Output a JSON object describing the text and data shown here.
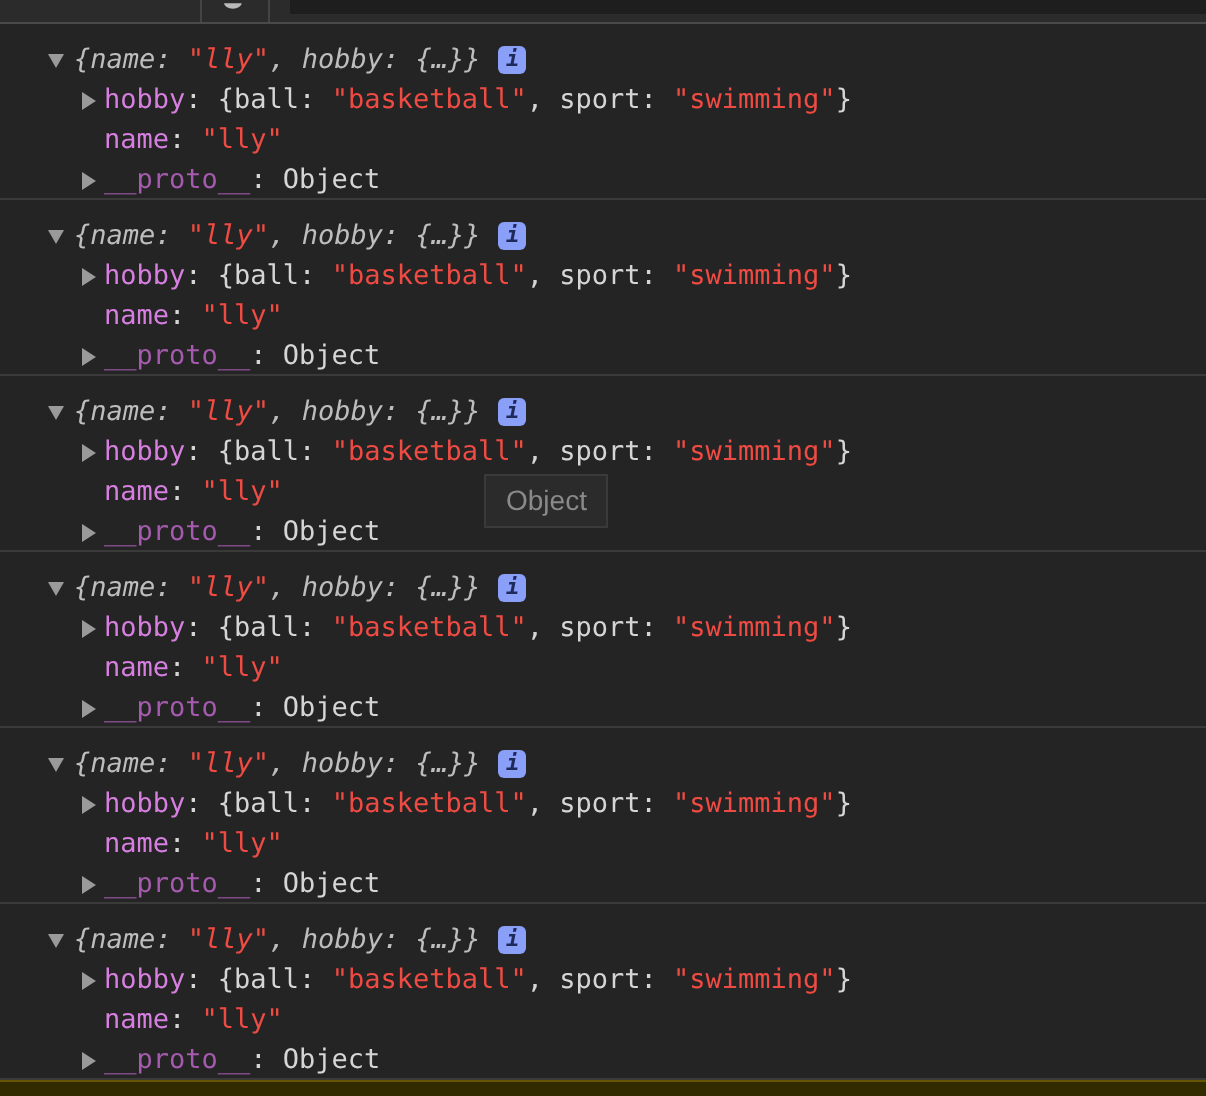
{
  "entries": [
    {
      "expanded": true,
      "badge": "i",
      "summary": [
        {
          "kind": "punct",
          "text": "{"
        },
        {
          "kind": "key",
          "text": "name"
        },
        {
          "kind": "punct",
          "text": ": "
        },
        {
          "kind": "string",
          "text": "\"lly\""
        },
        {
          "kind": "punct",
          "text": ", "
        },
        {
          "kind": "key",
          "text": "hobby"
        },
        {
          "kind": "punct",
          "text": ": {…}}"
        }
      ],
      "properties": [
        {
          "kind": "object",
          "expanded": false,
          "tokens": [
            {
              "kind": "key",
              "text": "hobby"
            },
            {
              "kind": "punct",
              "text": ": {"
            },
            {
              "kind": "plain",
              "text": "ball: "
            },
            {
              "kind": "string",
              "text": "\"basketball\""
            },
            {
              "kind": "punct",
              "text": ", "
            },
            {
              "kind": "plain",
              "text": "sport: "
            },
            {
              "kind": "string",
              "text": "\"swimming\""
            },
            {
              "kind": "punct",
              "text": "}"
            }
          ]
        },
        {
          "kind": "value",
          "tokens": [
            {
              "kind": "key",
              "text": "name"
            },
            {
              "kind": "punct",
              "text": ": "
            },
            {
              "kind": "string",
              "text": "\"lly\""
            }
          ]
        },
        {
          "kind": "object",
          "expanded": false,
          "tokens": [
            {
              "kind": "key_dim",
              "text": "__proto__"
            },
            {
              "kind": "punct",
              "text": ": "
            },
            {
              "kind": "plain",
              "text": "Object"
            }
          ]
        }
      ]
    },
    {
      "expanded": true,
      "badge": "i",
      "summary": [
        {
          "kind": "punct",
          "text": "{"
        },
        {
          "kind": "key",
          "text": "name"
        },
        {
          "kind": "punct",
          "text": ": "
        },
        {
          "kind": "string",
          "text": "\"lly\""
        },
        {
          "kind": "punct",
          "text": ", "
        },
        {
          "kind": "key",
          "text": "hobby"
        },
        {
          "kind": "punct",
          "text": ": {…}}"
        }
      ],
      "properties": [
        {
          "kind": "object",
          "expanded": false,
          "tokens": [
            {
              "kind": "key",
              "text": "hobby"
            },
            {
              "kind": "punct",
              "text": ": {"
            },
            {
              "kind": "plain",
              "text": "ball: "
            },
            {
              "kind": "string",
              "text": "\"basketball\""
            },
            {
              "kind": "punct",
              "text": ", "
            },
            {
              "kind": "plain",
              "text": "sport: "
            },
            {
              "kind": "string",
              "text": "\"swimming\""
            },
            {
              "kind": "punct",
              "text": "}"
            }
          ]
        },
        {
          "kind": "value",
          "tokens": [
            {
              "kind": "key",
              "text": "name"
            },
            {
              "kind": "punct",
              "text": ": "
            },
            {
              "kind": "string",
              "text": "\"lly\""
            }
          ]
        },
        {
          "kind": "object",
          "expanded": false,
          "tokens": [
            {
              "kind": "key_dim",
              "text": "__proto__"
            },
            {
              "kind": "punct",
              "text": ": "
            },
            {
              "kind": "plain",
              "text": "Object"
            }
          ]
        }
      ]
    },
    {
      "expanded": true,
      "badge": "i",
      "tooltip": "Object",
      "summary": [
        {
          "kind": "punct",
          "text": "{"
        },
        {
          "kind": "key",
          "text": "name"
        },
        {
          "kind": "punct",
          "text": ": "
        },
        {
          "kind": "string",
          "text": "\"lly\""
        },
        {
          "kind": "punct",
          "text": ", "
        },
        {
          "kind": "key",
          "text": "hobby"
        },
        {
          "kind": "punct",
          "text": ": {…}}"
        }
      ],
      "properties": [
        {
          "kind": "object",
          "expanded": false,
          "tokens": [
            {
              "kind": "key",
              "text": "hobby"
            },
            {
              "kind": "punct",
              "text": ": {"
            },
            {
              "kind": "plain",
              "text": "ball: "
            },
            {
              "kind": "string",
              "text": "\"basketball\""
            },
            {
              "kind": "punct",
              "text": ", "
            },
            {
              "kind": "plain",
              "text": "sport: "
            },
            {
              "kind": "string",
              "text": "\"swimming\""
            },
            {
              "kind": "punct",
              "text": "}"
            }
          ]
        },
        {
          "kind": "value",
          "tokens": [
            {
              "kind": "key",
              "text": "name"
            },
            {
              "kind": "punct",
              "text": ": "
            },
            {
              "kind": "string",
              "text": "\"lly\""
            }
          ]
        },
        {
          "kind": "object",
          "expanded": false,
          "tokens": [
            {
              "kind": "key_dim",
              "text": "__proto__"
            },
            {
              "kind": "punct",
              "text": ": "
            },
            {
              "kind": "plain",
              "text": "Object"
            }
          ]
        }
      ]
    },
    {
      "expanded": true,
      "badge": "i",
      "summary": [
        {
          "kind": "punct",
          "text": "{"
        },
        {
          "kind": "key",
          "text": "name"
        },
        {
          "kind": "punct",
          "text": ": "
        },
        {
          "kind": "string",
          "text": "\"lly\""
        },
        {
          "kind": "punct",
          "text": ", "
        },
        {
          "kind": "key",
          "text": "hobby"
        },
        {
          "kind": "punct",
          "text": ": {…}}"
        }
      ],
      "properties": [
        {
          "kind": "object",
          "expanded": false,
          "tokens": [
            {
              "kind": "key",
              "text": "hobby"
            },
            {
              "kind": "punct",
              "text": ": {"
            },
            {
              "kind": "plain",
              "text": "ball: "
            },
            {
              "kind": "string",
              "text": "\"basketball\""
            },
            {
              "kind": "punct",
              "text": ", "
            },
            {
              "kind": "plain",
              "text": "sport: "
            },
            {
              "kind": "string",
              "text": "\"swimming\""
            },
            {
              "kind": "punct",
              "text": "}"
            }
          ]
        },
        {
          "kind": "value",
          "tokens": [
            {
              "kind": "key",
              "text": "name"
            },
            {
              "kind": "punct",
              "text": ": "
            },
            {
              "kind": "string",
              "text": "\"lly\""
            }
          ]
        },
        {
          "kind": "object",
          "expanded": false,
          "tokens": [
            {
              "kind": "key_dim",
              "text": "__proto__"
            },
            {
              "kind": "punct",
              "text": ": "
            },
            {
              "kind": "plain",
              "text": "Object"
            }
          ]
        }
      ]
    },
    {
      "expanded": true,
      "badge": "i",
      "summary": [
        {
          "kind": "punct",
          "text": "{"
        },
        {
          "kind": "key",
          "text": "name"
        },
        {
          "kind": "punct",
          "text": ": "
        },
        {
          "kind": "string",
          "text": "\"lly\""
        },
        {
          "kind": "punct",
          "text": ", "
        },
        {
          "kind": "key",
          "text": "hobby"
        },
        {
          "kind": "punct",
          "text": ": {…}}"
        }
      ],
      "properties": [
        {
          "kind": "object",
          "expanded": false,
          "tokens": [
            {
              "kind": "key",
              "text": "hobby"
            },
            {
              "kind": "punct",
              "text": ": {"
            },
            {
              "kind": "plain",
              "text": "ball: "
            },
            {
              "kind": "string",
              "text": "\"basketball\""
            },
            {
              "kind": "punct",
              "text": ", "
            },
            {
              "kind": "plain",
              "text": "sport: "
            },
            {
              "kind": "string",
              "text": "\"swimming\""
            },
            {
              "kind": "punct",
              "text": "}"
            }
          ]
        },
        {
          "kind": "value",
          "tokens": [
            {
              "kind": "key",
              "text": "name"
            },
            {
              "kind": "punct",
              "text": ": "
            },
            {
              "kind": "string",
              "text": "\"lly\""
            }
          ]
        },
        {
          "kind": "object",
          "expanded": false,
          "tokens": [
            {
              "kind": "key_dim",
              "text": "__proto__"
            },
            {
              "kind": "punct",
              "text": ": "
            },
            {
              "kind": "plain",
              "text": "Object"
            }
          ]
        }
      ]
    },
    {
      "expanded": true,
      "badge": "i",
      "summary": [
        {
          "kind": "punct",
          "text": "{"
        },
        {
          "kind": "key",
          "text": "name"
        },
        {
          "kind": "punct",
          "text": ": "
        },
        {
          "kind": "string",
          "text": "\"lly\""
        },
        {
          "kind": "punct",
          "text": ", "
        },
        {
          "kind": "key",
          "text": "hobby"
        },
        {
          "kind": "punct",
          "text": ": {…}}"
        }
      ],
      "properties": [
        {
          "kind": "object",
          "expanded": false,
          "tokens": [
            {
              "kind": "key",
              "text": "hobby"
            },
            {
              "kind": "punct",
              "text": ": {"
            },
            {
              "kind": "plain",
              "text": "ball: "
            },
            {
              "kind": "string",
              "text": "\"basketball\""
            },
            {
              "kind": "punct",
              "text": ", "
            },
            {
              "kind": "plain",
              "text": "sport: "
            },
            {
              "kind": "string",
              "text": "\"swimming\""
            },
            {
              "kind": "punct",
              "text": "}"
            }
          ]
        },
        {
          "kind": "value",
          "tokens": [
            {
              "kind": "key",
              "text": "name"
            },
            {
              "kind": "punct",
              "text": ": "
            },
            {
              "kind": "string",
              "text": "\"lly\""
            }
          ]
        },
        {
          "kind": "object",
          "expanded": false,
          "tokens": [
            {
              "kind": "key_dim",
              "text": "__proto__"
            },
            {
              "kind": "punct",
              "text": ": "
            },
            {
              "kind": "plain",
              "text": "Object"
            }
          ]
        }
      ]
    }
  ],
  "warning_row": {
    "kind": "warning"
  }
}
